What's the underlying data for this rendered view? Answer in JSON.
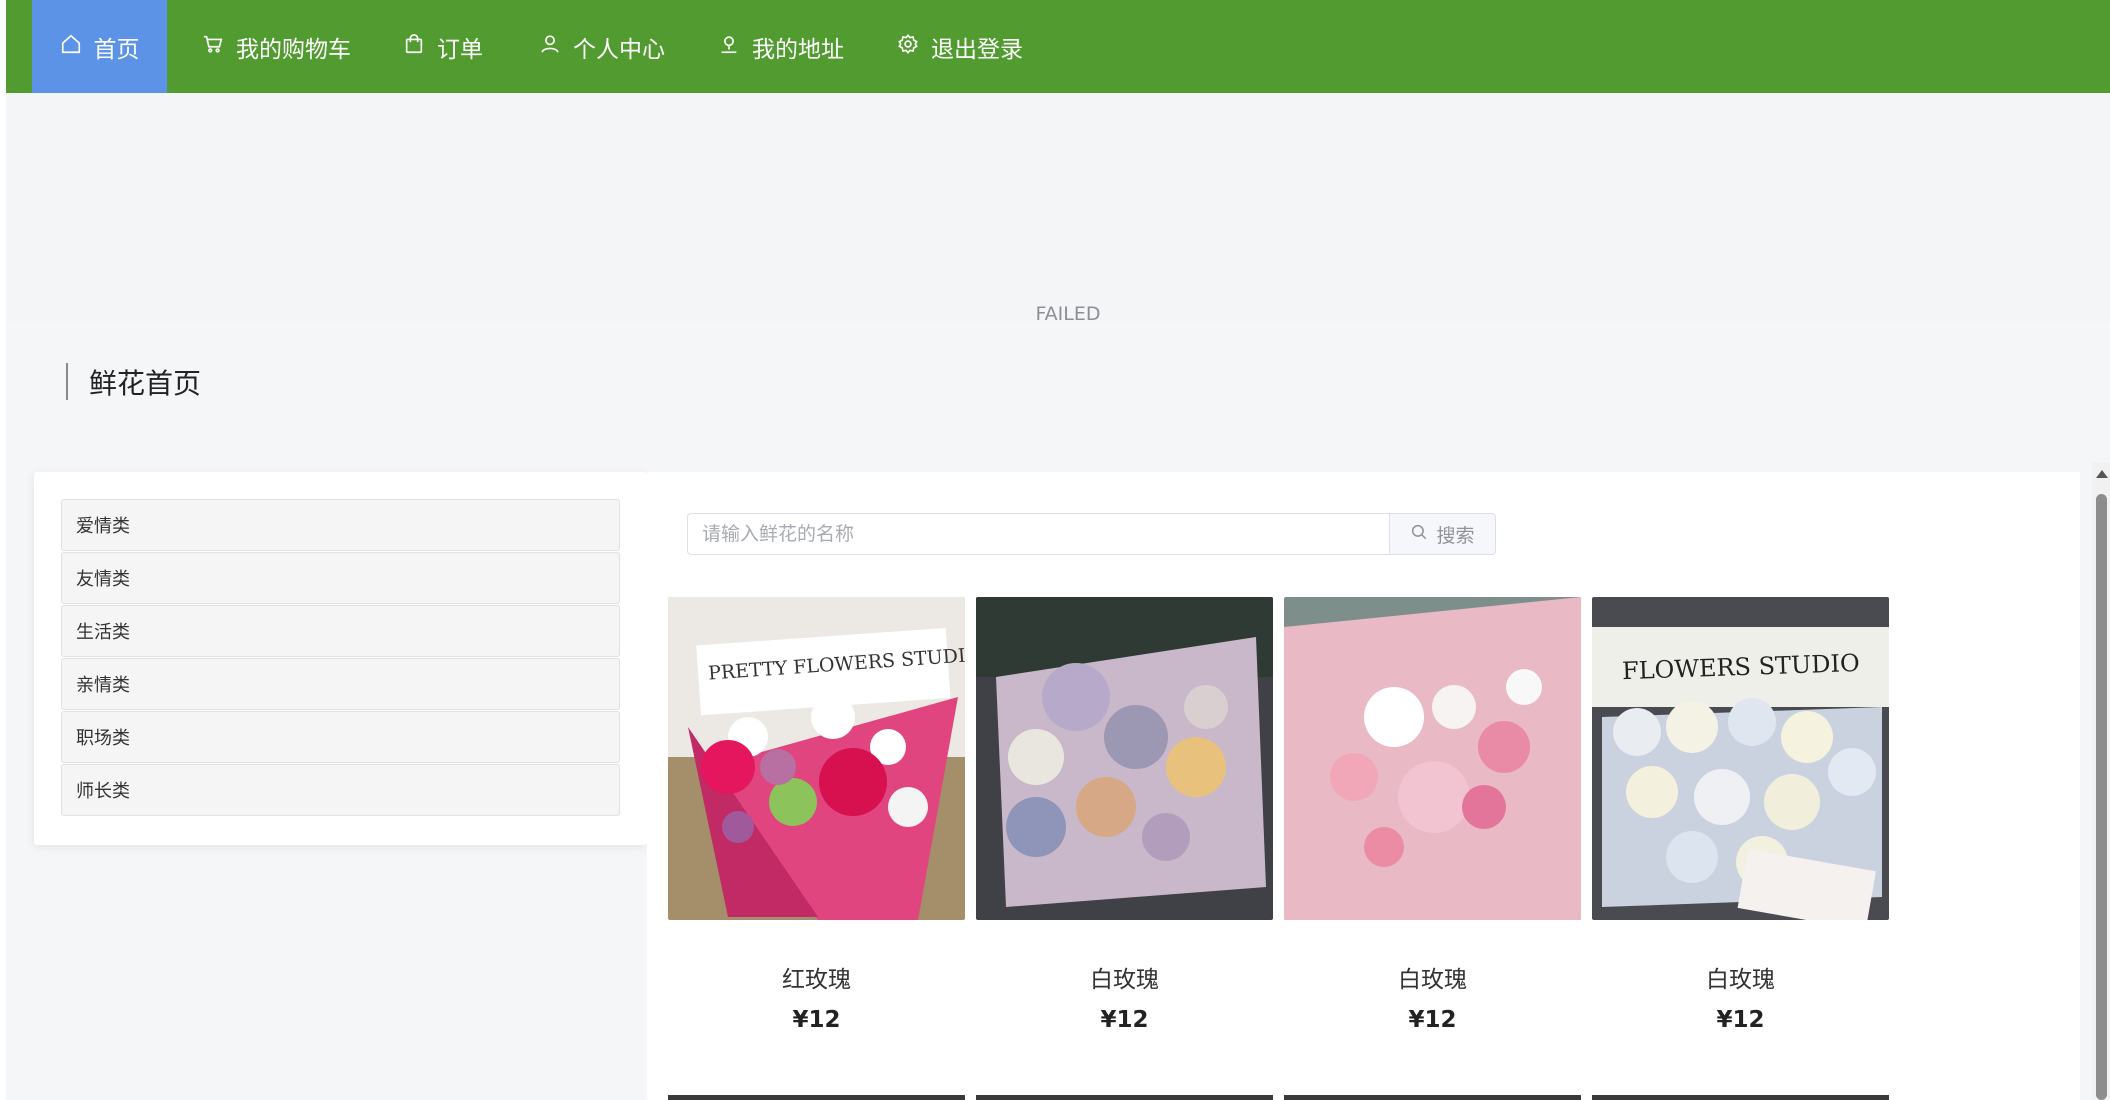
{
  "nav": {
    "items": [
      {
        "label": "首页",
        "icon": "home-icon"
      },
      {
        "label": "我的购物车",
        "icon": "cart-icon"
      },
      {
        "label": "订单",
        "icon": "bag-icon"
      },
      {
        "label": "个人中心",
        "icon": "user-icon"
      },
      {
        "label": "我的地址",
        "icon": "location-icon"
      },
      {
        "label": "退出登录",
        "icon": "gear-icon"
      }
    ],
    "active_index": 0
  },
  "colors": {
    "nav_bg": "#519b30",
    "nav_active": "#5c93e6"
  },
  "banner": {
    "status_text": "FAILED",
    "active_dot": 1
  },
  "section": {
    "title": "鲜花首页"
  },
  "categories": [
    "爱情类",
    "友情类",
    "生活类",
    "亲情类",
    "职场类",
    "师长类"
  ],
  "search": {
    "placeholder": "请输入鲜花的名称",
    "button_label": "搜索"
  },
  "products": [
    {
      "name": "红玫瑰",
      "price": "¥12",
      "image_text": "PRETTY FLOWERS STUDIO"
    },
    {
      "name": "白玫瑰",
      "price": "¥12"
    },
    {
      "name": "白玫瑰",
      "price": "¥12"
    },
    {
      "name": "白玫瑰",
      "price": "¥12",
      "image_text": "FLOWERS STUDIO"
    }
  ]
}
